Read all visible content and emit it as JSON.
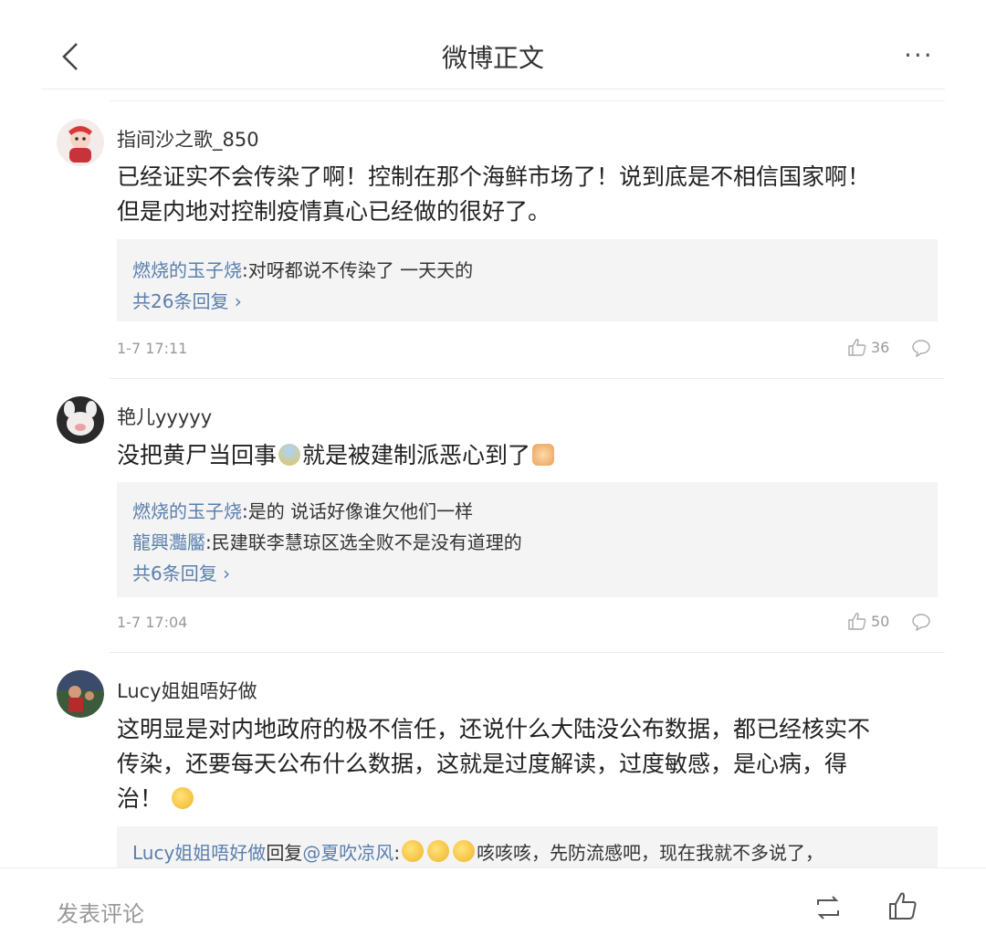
{
  "header": {
    "title": "微博正文",
    "more": "···"
  },
  "comments": [
    {
      "user": "指间沙之歌_850",
      "text_line1": "已经证实不会传染了啊！控制在那个海鲜市场了！说到底是不相信国家啊！",
      "text_line2": "但是内地对控制疫情真心已经做的很好了。",
      "replies": [
        {
          "user": "燃烧的玉子烧",
          "text": ":对呀都说不传染了 一天天的"
        }
      ],
      "more_replies": "共26条回复 ›",
      "time": "1-7 17:11",
      "likes": "36"
    },
    {
      "user": "艳儿yyyyy",
      "text_part1": "没把黄尸当回事",
      "text_part2": "就是被建制派恶心到了",
      "replies": [
        {
          "user": "燃烧的玉子烧",
          "text": ":是的 说话好像谁欠他们一样"
        },
        {
          "user": "龍興灩靨",
          "text": ":民建联李慧琼区选全败不是没有道理的"
        }
      ],
      "more_replies": "共6条回复 ›",
      "time": "1-7 17:04",
      "likes": "50"
    },
    {
      "user": "Lucy姐姐唔好做",
      "text_line1": "这明显是对内地政府的极不信任，还说什么大陆没公布数据，都已经核实不",
      "text_line2": "传染，还要每天公布什么数据，这就是过度解读，过度敏感，是心病，得",
      "text_line3": "治！",
      "replies": [
        {
          "user": "Lucy姐姐唔好做",
          "mid": "回复",
          "mention": "@夏吹凉风",
          "text_after_colon": ":",
          "text": "咳咳咳，先防流感吧，现在我就不多说了，"
        }
      ]
    }
  ],
  "bottom": {
    "placeholder": "发表评论"
  },
  "icons": [
    "back-arrow-icon",
    "more-icon",
    "thumbs-up-icon",
    "comment-bubble-icon",
    "repost-icon"
  ],
  "colors": {
    "link_blue": "#5a7fae",
    "reply_bg": "#f4f4f4",
    "meta_gray": "#999999"
  }
}
